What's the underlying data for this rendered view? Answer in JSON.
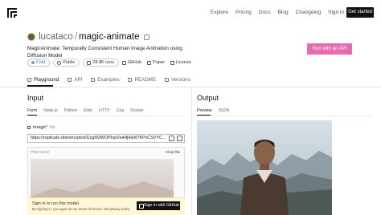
{
  "nav": {
    "links": [
      "Explore",
      "Pricing",
      "Docs",
      "Blog",
      "Changelog",
      "Sign in"
    ],
    "cta": "Get started"
  },
  "header": {
    "owner": "lucataco",
    "separator": "/",
    "model": "magic-animate",
    "description": "MagicAnimate: Temporally Consistent Human Image Animation using Diffusion Model",
    "run_api": "Run with an API"
  },
  "badges": {
    "status": "Cold",
    "visibility": "Public",
    "runs": "28.8K runs",
    "github": "GitHub",
    "paper": "Paper",
    "license": "License"
  },
  "tabs": [
    "Playground",
    "API",
    "Examples",
    "README",
    "Versions"
  ],
  "input": {
    "title": "Input",
    "subtabs": [
      "Form",
      "Node.js",
      "Python",
      "Elixir",
      "HTTP",
      "Cog",
      "Docker"
    ],
    "field_label": "image",
    "field_asterisk": "*",
    "field_type": "file",
    "url_value": "https://replicate.delivery/pbxt/UzgM3WOPIopVwHfj4aW7KPxCSVYC...",
    "preview_label": "PREVIEW",
    "clear_file": "Clear file"
  },
  "signin": {
    "line1": "Sign in to run this model.",
    "line2": "By signing in, you agree to our terms of service and privacy policy",
    "button": "Sign in with GitHub"
  },
  "output": {
    "title": "Output",
    "subtabs": [
      "Preview",
      "JSON"
    ]
  }
}
